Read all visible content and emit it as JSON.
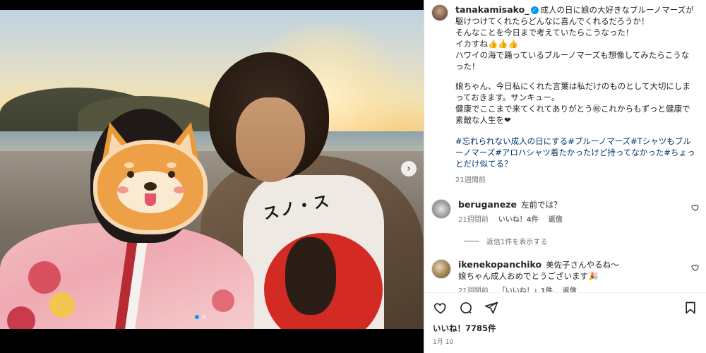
{
  "post": {
    "username": "tanakamisako_",
    "caption_lines": [
      "成人の日に娘の大好きなブルーノマーズが駆けつけてくれたらどんなに喜んでくれるだろうか！",
      "そんなことを今日まで考えていたらこうなった！",
      "イカすね👍👍👍",
      "ハワイの海で踊っているブルーノマーズも想像してみたらこうなった！",
      "",
      "娘ちゃん、今日私にくれた言葉は私だけのものとして大切にしまっておきます。サンキュー。",
      "健康でここまで来てくれてありがとう㊗これからもずっと健康で素敵な人生を❤"
    ],
    "hashtags": "#忘れられない成人の日にする#ブルーノマーズ#Tシャツもブルーノマーズ#アロハシャツ着たかったけど持ってなかった#ちょっとだけ似てる？",
    "time_ago": "21週間前",
    "shirt_text": "スノ・ス"
  },
  "comments": [
    {
      "username": "beruganeze",
      "text": "左前では？",
      "time_ago": "21週間前",
      "likes": "いいね！4件",
      "reply": "返信",
      "view_replies": "返信1件を表示する"
    },
    {
      "username": "ikenekopanchiko",
      "text_line1": "美佐子さんやるね〜",
      "text_line2": "娘ちゃん成人おめでとうございます🎉",
      "time_ago": "21週間前",
      "likes": "「いいね！」1件",
      "reply": "返信"
    }
  ],
  "footer": {
    "likes": "いいね！7785件",
    "date": "1月 10"
  },
  "icons": {
    "heart": "heart-icon",
    "comment": "comment-icon",
    "share": "share-icon",
    "save": "bookmark-icon",
    "next": "chevron-right-icon"
  },
  "colors": {
    "link": "#00376b",
    "verified": "#0095f6",
    "meta": "#737373",
    "text": "#262626"
  }
}
